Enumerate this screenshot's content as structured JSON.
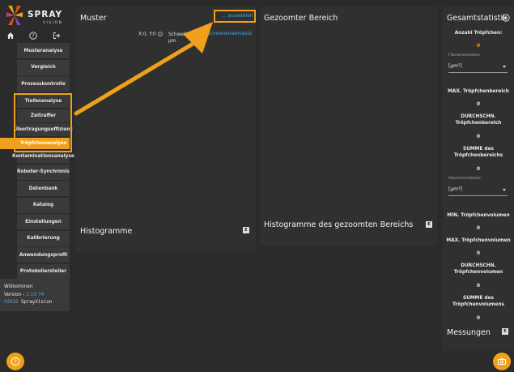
{
  "app": {
    "brand": "SPRAY",
    "brand_sub": "VISION",
    "accent": "#f0a01a",
    "link_color": "#4aa3df"
  },
  "toolbar_icons": [
    "home-icon",
    "help-circle-icon",
    "logout-icon"
  ],
  "sidebar": {
    "items": [
      {
        "label": "Musteranalyse"
      },
      {
        "label": "Vergleich"
      },
      {
        "label": "Prozesskontrolle"
      },
      {
        "label": "Tiefenanalyse"
      },
      {
        "label": "Zeitraffer"
      },
      {
        "label": "Übertragungseffizienz"
      },
      {
        "label": "Tröpfchenanalyse"
      },
      {
        "label": "Kontaminationsanalyse"
      },
      {
        "label": "Roboter-Synchronisierung"
      },
      {
        "label": "Datenbank"
      },
      {
        "label": "Katalog"
      },
      {
        "label": "Einstellungen"
      },
      {
        "label": "Kalibrierung"
      },
      {
        "label": "Anwendungsprofil"
      },
      {
        "label": "Protokollersteller"
      }
    ],
    "active_item": "Tröpfchenanalyse"
  },
  "welcome": {
    "greeting": "Willkommen",
    "version_label": "Version - ",
    "version": "1.10.74",
    "copyright_year": "©2026",
    "copyright_name": " SprayVision"
  },
  "muster": {
    "title": "Muster",
    "select_link": "... auswählen",
    "coords": "X:0, Y:0",
    "threshold_label": "Schwellen",
    "threshold_unit": "µm",
    "threshold_link": "Schwellenwertauto",
    "histogram_title": "Histogramme",
    "histogram_badge": "E"
  },
  "zoom": {
    "title": "Gezoomter Bereich",
    "histogram_title": "Histogramme des gezoomten Bereichs",
    "histogram_badge": "E"
  },
  "stats": {
    "title": "Gesamtstatistik",
    "count_label": "Anzahl Tröpfchen:",
    "count_value": "0",
    "area_unit_caption": "Flächeneinheiten",
    "area_unit": "[µm²]",
    "max_area_label": "MAX. Tröpfchenbereich",
    "max_area_value": "0",
    "avg_area_label_1": "DURCHSCHN.",
    "avg_area_label_2": "Tröpfchenbereich",
    "avg_area_value": "0",
    "sum_area_label_1": "SUMME des",
    "sum_area_label_2": "Tröpfchenbereichs",
    "sum_area_value": "0",
    "vol_unit_caption": "Volumeneinheiten",
    "vol_unit": "[µm³]",
    "min_vol_label": "MIN. Tröpfchenvolumen",
    "min_vol_value": "0",
    "max_vol_label": "MAX. Tröpfchenvolumen",
    "max_vol_value": "0",
    "avg_vol_label_1": "DURCHSCHN.",
    "avg_vol_label_2": "Tröpfchenvolumen",
    "avg_vol_value": "0",
    "sum_vol_label_1": "SUMME des",
    "sum_vol_label_2": "Tröpfchenvolumens",
    "sum_vol_value": "0",
    "measurements_title": "Messungen",
    "measurements_badge": "E"
  }
}
